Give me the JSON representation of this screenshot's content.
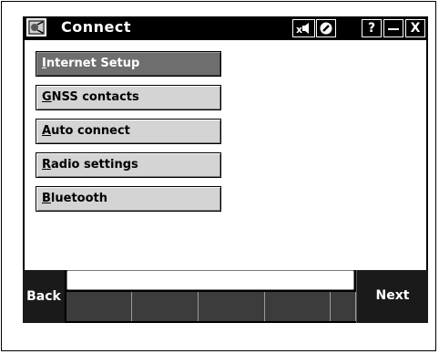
{
  "window": {
    "title": "Connect"
  },
  "title_bar": {
    "icons": [
      "app-icon",
      "speaker-icon",
      "settings-icon"
    ],
    "help_label": "?",
    "minimize_label": "—",
    "close_label": "X"
  },
  "menu": {
    "items": [
      {
        "first": "I",
        "rest": "nternet Setup",
        "selected": true
      },
      {
        "first": "G",
        "rest": "NSS contacts",
        "selected": false
      },
      {
        "first": "A",
        "rest": "uto connect",
        "selected": false
      },
      {
        "first": "R",
        "rest": "adio settings",
        "selected": false
      },
      {
        "first": "B",
        "rest": "luetooth",
        "selected": false
      }
    ]
  },
  "footer": {
    "back_label": "Back",
    "next_label": "Next"
  }
}
